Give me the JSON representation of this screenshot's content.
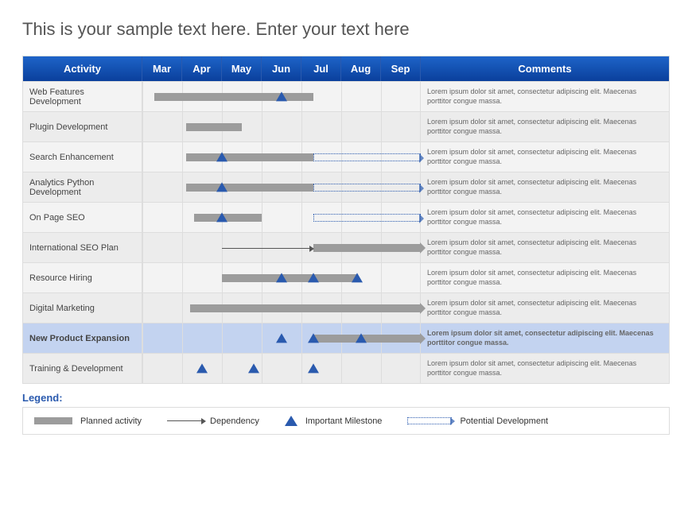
{
  "title": "This is your sample text here. Enter your text here",
  "headers": {
    "activity": "Activity",
    "months": [
      "Mar",
      "Apr",
      "May",
      "Jun",
      "Jul",
      "Aug",
      "Sep"
    ],
    "comments": "Comments"
  },
  "comment_text": "Lorem ipsum dolor sit amet, consectetur adipiscing elit. Maecenas porttitor congue massa.",
  "legend": {
    "title": "Legend:",
    "planned": "Planned activity",
    "dependency": "Dependency",
    "milestone": "Important Milestone",
    "potential": "Potential Development"
  },
  "rows": [
    {
      "name": "Web Features Development"
    },
    {
      "name": "Plugin Development"
    },
    {
      "name": "Search Enhancement"
    },
    {
      "name": "Analytics Python Development"
    },
    {
      "name": "On Page SEO"
    },
    {
      "name": "International  SEO Plan"
    },
    {
      "name": "Resource Hiring"
    },
    {
      "name": "Digital Marketing"
    },
    {
      "name": "New Product  Expansion",
      "highlight": true
    },
    {
      "name": "Training & Development"
    }
  ],
  "chart_data": {
    "type": "gantt",
    "title": "This is your sample text here. Enter your text here",
    "x_categories": [
      "Mar",
      "Apr",
      "May",
      "Jun",
      "Jul",
      "Aug",
      "Sep"
    ],
    "today_marker": 4.3,
    "tasks": [
      {
        "activity": "Web Features Development",
        "planned": [
          0.3,
          4.3
        ],
        "milestones": [
          3.5
        ]
      },
      {
        "activity": "Plugin Development",
        "planned": [
          1.1,
          2.5
        ]
      },
      {
        "activity": "Search Enhancement",
        "planned": [
          1.1,
          4.3
        ],
        "milestones": [
          2.0
        ],
        "potential": [
          4.3,
          7.0
        ]
      },
      {
        "activity": "Analytics Python Development",
        "planned": [
          1.1,
          4.3
        ],
        "milestones": [
          2.0
        ],
        "potential": [
          4.3,
          7.0
        ]
      },
      {
        "activity": "On Page SEO",
        "planned": [
          1.3,
          3.0
        ],
        "milestones": [
          2.0
        ],
        "potential": [
          4.3,
          7.0
        ]
      },
      {
        "activity": "International SEO Plan",
        "planned": [
          4.3,
          7.0
        ],
        "arrow": true,
        "dependency_from": 2.0
      },
      {
        "activity": "Resource Hiring",
        "planned": [
          2.0,
          5.4
        ],
        "milestones": [
          3.5,
          4.3,
          5.4
        ]
      },
      {
        "activity": "Digital Marketing",
        "planned": [
          1.2,
          7.0
        ],
        "arrow": true
      },
      {
        "activity": "New Product Expansion",
        "planned": [
          4.3,
          7.0
        ],
        "arrow": true,
        "milestones": [
          3.5,
          4.3,
          5.5
        ],
        "highlight": true
      },
      {
        "activity": "Training & Development",
        "milestones": [
          1.5,
          2.8,
          4.3
        ]
      }
    ],
    "legend": [
      "Planned activity",
      "Dependency",
      "Important Milestone",
      "Potential Development"
    ]
  }
}
